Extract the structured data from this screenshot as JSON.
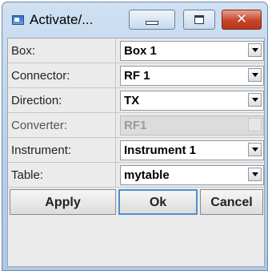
{
  "window": {
    "title": "Activate/..."
  },
  "form": {
    "rows": [
      {
        "label": "Box:",
        "value": "Box 1"
      },
      {
        "label": "Connector:",
        "value": "RF 1"
      },
      {
        "label": "Direction:",
        "value": "TX"
      },
      {
        "label": "Converter:",
        "value": "RF1",
        "disabled": true
      },
      {
        "label": "Instrument:",
        "value": "Instrument 1"
      },
      {
        "label": "Table:",
        "value": "mytable"
      }
    ]
  },
  "buttons": {
    "apply": "Apply",
    "ok": "Ok",
    "cancel": "Cancel"
  },
  "icons": {
    "app": "window-app-icon",
    "minimize": "minimize-icon",
    "maximize": "maximize-icon",
    "close": "close-icon",
    "dropdown": "chevron-down-icon"
  },
  "colors": {
    "close_button": "#c6452a",
    "default_button_border": "#4f8fd0",
    "titlebar": "#b8cfe8"
  }
}
